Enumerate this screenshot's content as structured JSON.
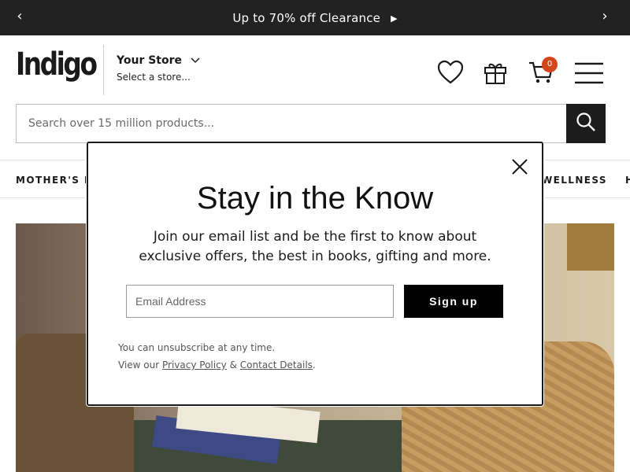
{
  "promo": {
    "text": "Up to 70% off Clearance",
    "play_glyph": "▶",
    "prev_glyph": "‹",
    "next_glyph": "›"
  },
  "header": {
    "logo": "Indigo",
    "store_title": "Your Store",
    "store_subtitle": "Select a store...",
    "cart_count": "0"
  },
  "icons": {
    "wishlist": "heart-icon",
    "gift": "gift-icon",
    "cart": "cart-icon",
    "menu": "hamburger-menu-icon",
    "search": "search-icon",
    "close": "close-icon"
  },
  "search": {
    "placeholder": "Search over 15 million products..."
  },
  "nav": {
    "item_left": "MOTHER'S D",
    "item_right": "WELLNESS",
    "item_edge": "H"
  },
  "modal": {
    "title": "Stay in the Know",
    "body_line1": "Join our email list and be the first to know about",
    "body_line2": "exclusive offers, the best in books, gifting and more.",
    "email_placeholder": "Email Address",
    "signup_label": "Sign up",
    "unsubscribe": "You can unsubscribe at any time.",
    "view_our": "View our",
    "privacy_link": "Privacy Policy",
    "amp": "&",
    "contact_link": "Contact Details",
    "period": "."
  },
  "colors": {
    "promo_bg": "#222222",
    "cart_badge": "#d4471d",
    "button_bg": "#000000"
  }
}
